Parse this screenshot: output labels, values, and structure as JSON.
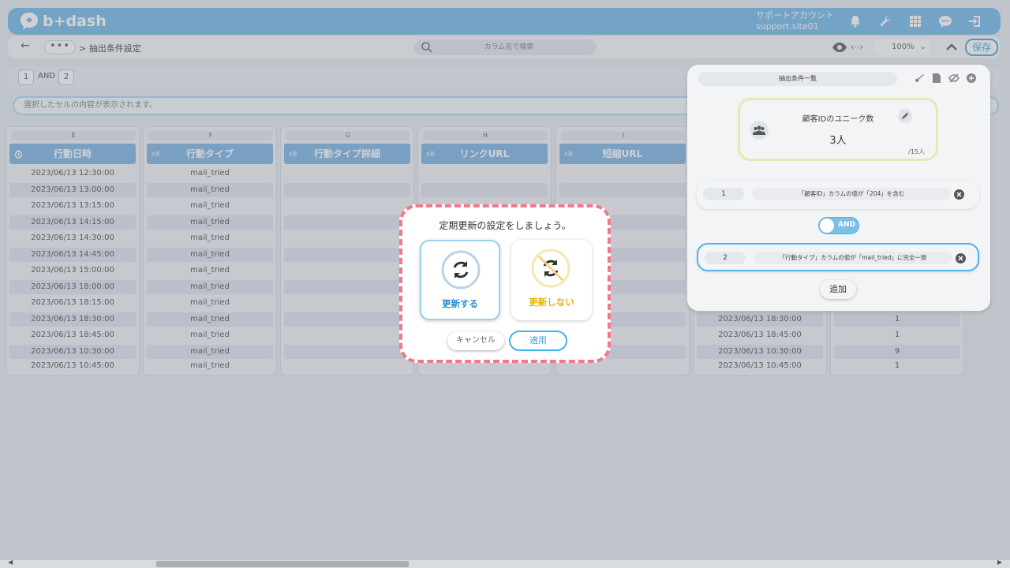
{
  "app": {
    "logo_text": "b+dash",
    "account_name": "サポートアカウント",
    "account_site": "support.site01",
    "brand_color": "#6db7e6",
    "icons": [
      "bell-icon",
      "wrench-icon",
      "grid-icon",
      "chat-icon",
      "logout-icon"
    ]
  },
  "toolbar": {
    "breadcrumb_more": "•••",
    "breadcrumb": "> 抽出条件設定",
    "search_placeholder": "カラム名で検索",
    "zoom": "100%",
    "save_label": "保存"
  },
  "conditions_bar": {
    "chip1": "1",
    "operator": "AND",
    "chip2": "2"
  },
  "selection_text": "選択したセルの内容が表示されます。",
  "columns": [
    {
      "letter": "E",
      "header": "行動日時",
      "type_icon": "clock-icon",
      "cells": [
        "2023/06/13 12:30:00",
        "2023/06/13 13:00:00",
        "2023/06/13 13:15:00",
        "2023/06/13 14:15:00",
        "2023/06/13 14:30:00",
        "2023/06/13 14:45:00",
        "2023/06/13 15:00:00",
        "2023/06/13 18:00:00",
        "2023/06/13 18:15:00",
        "2023/06/13 18:30:00",
        "2023/06/13 18:45:00",
        "2023/06/13 10:30:00",
        "2023/06/13 10:45:00"
      ]
    },
    {
      "letter": "F",
      "header": "行動タイプ",
      "type_icon": "text-type-icon",
      "type_label": "aあ",
      "cells": [
        "mail_tried",
        "mail_tried",
        "mail_tried",
        "mail_tried",
        "mail_tried",
        "mail_tried",
        "mail_tried",
        "mail_tried",
        "mail_tried",
        "mail_tried",
        "mail_tried",
        "mail_tried",
        "mail_tried"
      ]
    },
    {
      "letter": "G",
      "header": "行動タイプ詳細",
      "type_icon": "text-type-icon",
      "type_label": "aあ",
      "cells": []
    },
    {
      "letter": "H",
      "header": "リンクURL",
      "type_icon": "text-type-icon",
      "type_label": "aあ",
      "cells": []
    },
    {
      "letter": "I",
      "header": "短縮URL",
      "type_icon": "text-type-icon",
      "type_label": "aあ",
      "cells": []
    },
    {
      "letter": "",
      "header": "",
      "cells": [
        "",
        "",
        "",
        "",
        "",
        "",
        "",
        "",
        "",
        "2023/06/13 18:30:00",
        "2023/06/13 18:45:00",
        "2023/06/13 10:30:00",
        "2023/06/13 10:45:00"
      ]
    },
    {
      "letter": "",
      "header": "",
      "cells": [
        "",
        "",
        "",
        "",
        "",
        "",
        "",
        "",
        "",
        "1",
        "1",
        "9",
        "1"
      ]
    }
  ],
  "panel": {
    "tab_label": "抽出条件一覧",
    "metric_title": "顧客IDのユニーク数",
    "metric_value": "3人",
    "metric_total": "/15人",
    "conditions": [
      {
        "num": "1",
        "text": "「顧客ID」カラムの値が「204」を含む"
      },
      {
        "num": "2",
        "text": "「行動タイプ」カラムの値が「mail_tried」に完全一致"
      }
    ],
    "and_label": "AND",
    "add_label": "追加"
  },
  "modal": {
    "title": "定期更新の設定をしましょう。",
    "option_update": "更新する",
    "option_no_update": "更新しない",
    "update_color": "#2a8fd6",
    "no_update_color": "#e8b400",
    "cancel_label": "キャンセル",
    "apply_label": "適用",
    "dashed_border_color": "#ee7a8a"
  }
}
